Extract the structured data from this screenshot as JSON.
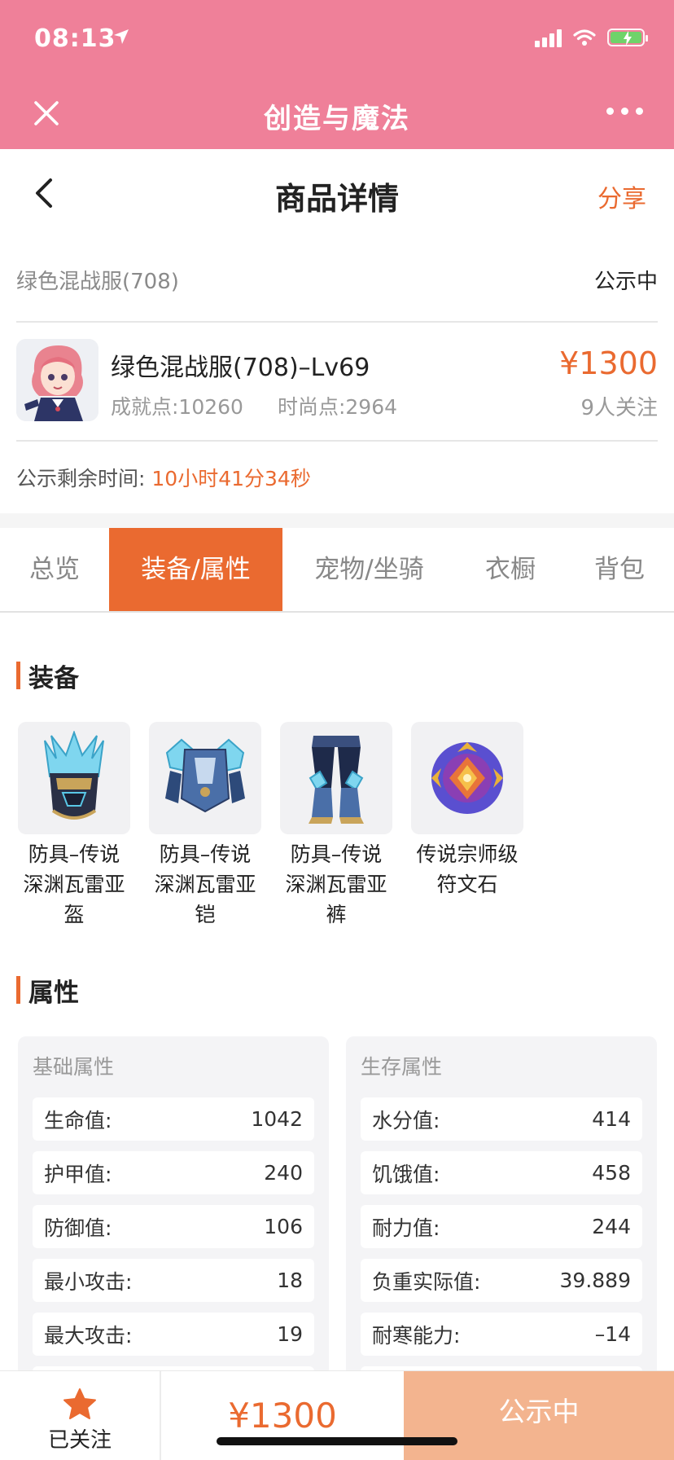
{
  "status_bar": {
    "time": "08:13"
  },
  "mini_program": {
    "title": "创造与魔法"
  },
  "header": {
    "title": "商品详情",
    "share_label": "分享"
  },
  "listing": {
    "server": "绿色混战服(708)",
    "status": "公示中",
    "name": "绿色混战服(708)–Lv69",
    "achievement": "成就点:10260",
    "fashion": "时尚点:2964",
    "price": "¥1300",
    "followers": "9人关注",
    "remaining_label": "公示剩余时间:",
    "remaining_value": "10小时41分34秒"
  },
  "tabs": [
    {
      "label": "总览",
      "active": false
    },
    {
      "label": "装备/属性",
      "active": true
    },
    {
      "label": "宠物/坐骑",
      "active": false
    },
    {
      "label": "衣橱",
      "active": false
    },
    {
      "label": "背包",
      "active": false
    }
  ],
  "equipment": {
    "title": "装备",
    "items": [
      {
        "line1": "防具–传说",
        "line2": "深渊瓦雷亚",
        "line3": "盔",
        "icon": "helmet-icon"
      },
      {
        "line1": "防具–传说",
        "line2": "深渊瓦雷亚",
        "line3": "铠",
        "icon": "armor-icon"
      },
      {
        "line1": "防具–传说",
        "line2": "深渊瓦雷亚",
        "line3": "裤",
        "icon": "pants-icon"
      },
      {
        "line1": "传说宗师级",
        "line2": "符文石",
        "line3": "",
        "icon": "rune-stone-icon"
      }
    ]
  },
  "attributes": {
    "title": "属性",
    "basic": {
      "title": "基础属性",
      "rows": [
        {
          "label": "生命值:",
          "value": "1042"
        },
        {
          "label": "护甲值:",
          "value": "240"
        },
        {
          "label": "防御值:",
          "value": "106"
        },
        {
          "label": "最小攻击:",
          "value": "18"
        },
        {
          "label": "最大攻击:",
          "value": "19"
        }
      ]
    },
    "survival": {
      "title": "生存属性",
      "rows": [
        {
          "label": "水分值:",
          "value": "414"
        },
        {
          "label": "饥饿值:",
          "value": "458"
        },
        {
          "label": "耐力值:",
          "value": "244"
        },
        {
          "label": "负重实际值:",
          "value": "39.889"
        },
        {
          "label": "耐寒能力:",
          "value": "–14"
        }
      ]
    }
  },
  "bottom_bar": {
    "follow_label": "已关注",
    "price": "¥1300",
    "action_label": "公示中"
  },
  "colors": {
    "brand_pink": "#ef8099",
    "accent_orange": "#ea6a30",
    "action_disabled": "#f3b48f"
  }
}
